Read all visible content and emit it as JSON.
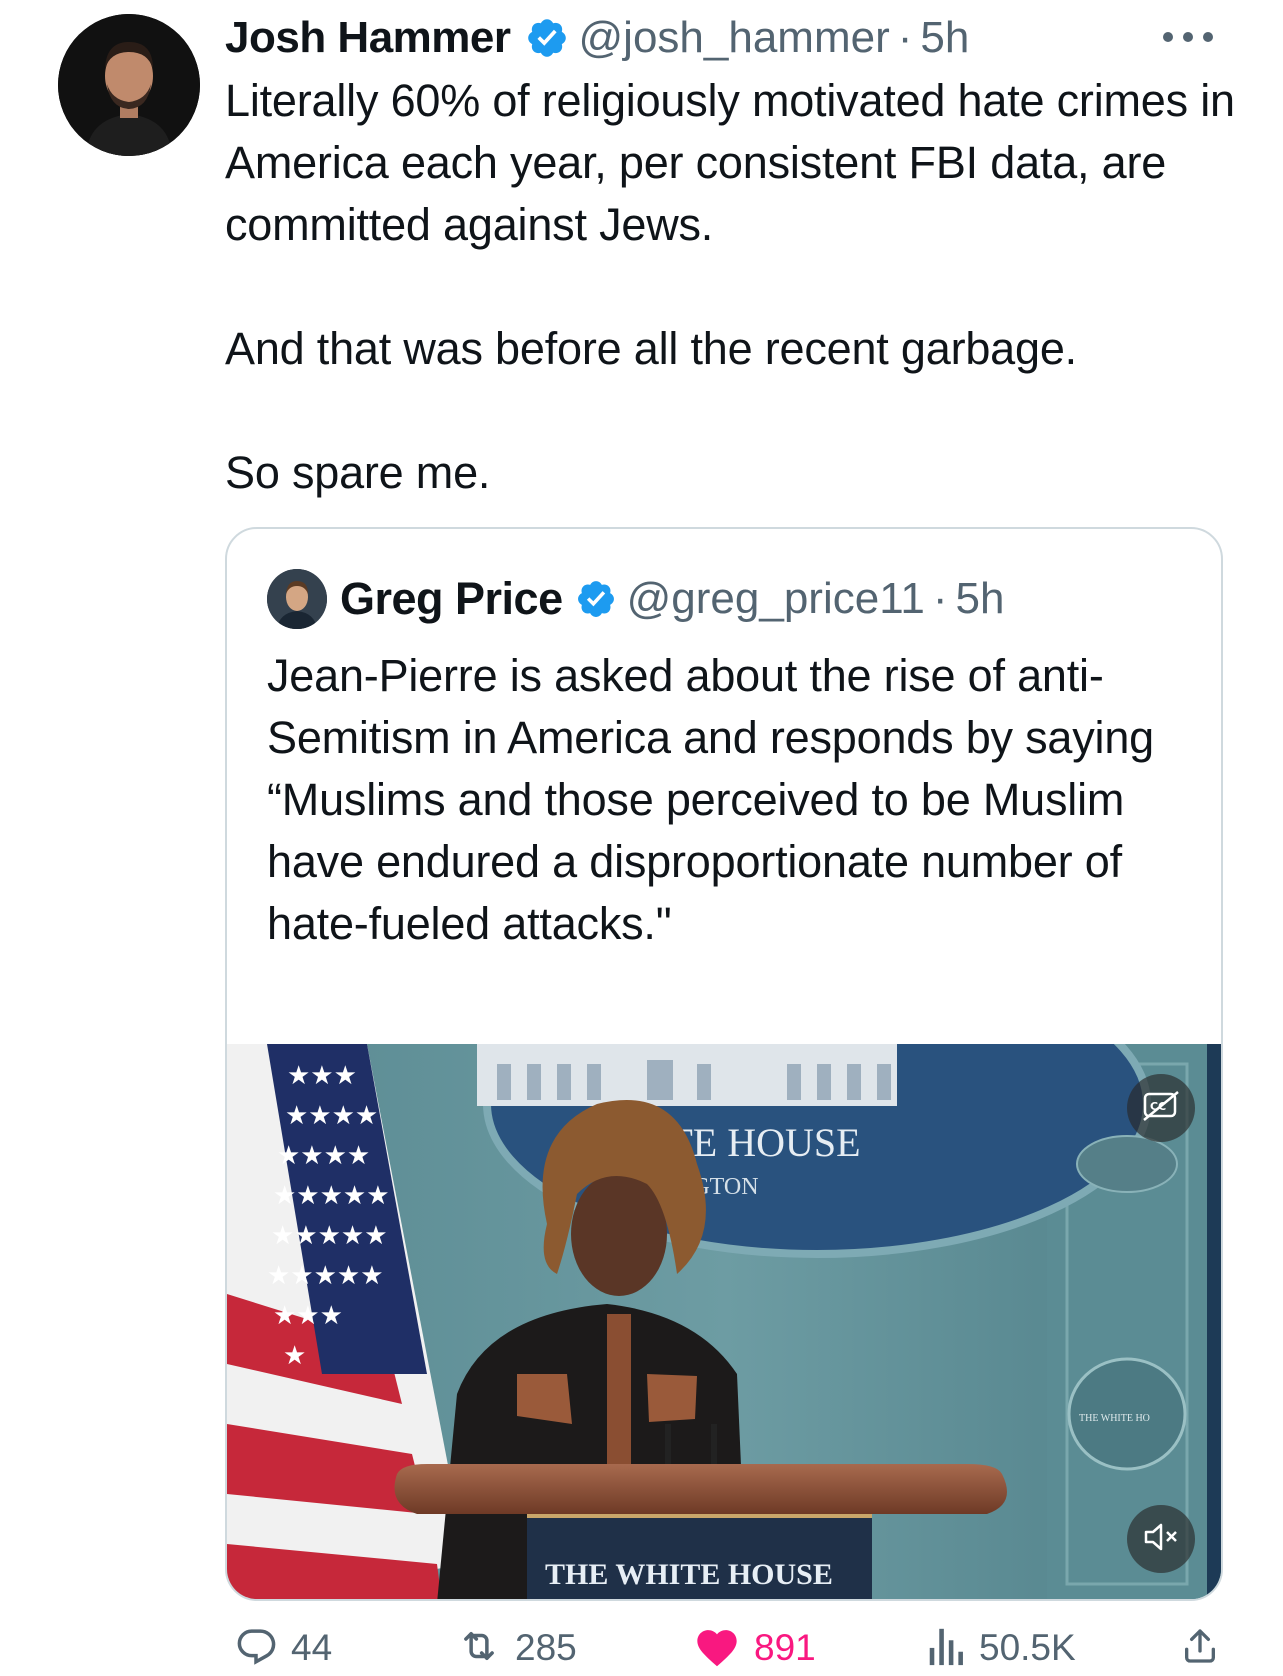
{
  "tweet": {
    "author": {
      "display_name": "Josh Hammer",
      "handle": "@josh_hammer",
      "time": "5h",
      "separator": "·"
    },
    "text": "Literally 60% of religiously motivated hate crimes in America each year, per consistent FBI data, are committed against Jews.\n\nAnd that was before all the recent garbage.\n\nSo spare me.",
    "quote": {
      "author": {
        "display_name": "Greg Price",
        "handle": "@greg_price11",
        "time": "5h",
        "separator": "·"
      },
      "text": "Jean-Pierre is asked about the rise of anti-Semitism in America and responds by saying “Muslims and those perceived to be Muslim have endured a disproportionate number of hate-fueled attacks.\"",
      "media": {
        "backdrop_text_1": "ITE HOUSE",
        "backdrop_text_2": "INGTON",
        "podium_text": "THE WHITE HOUSE",
        "side_seal_text": "THE WHITE HO"
      }
    },
    "stats": {
      "replies": "44",
      "reposts": "285",
      "likes": "891",
      "views": "50.5K"
    }
  },
  "colors": {
    "text": "#0f1419",
    "secondary": "#536471",
    "verified": "#1d9bf0",
    "like": "#f91880",
    "border": "#cfd9de"
  },
  "icons": [
    "verified-badge-icon",
    "more-icon",
    "reply-icon",
    "repost-icon",
    "like-icon",
    "views-icon",
    "share-icon",
    "captions-icon",
    "mute-icon"
  ]
}
